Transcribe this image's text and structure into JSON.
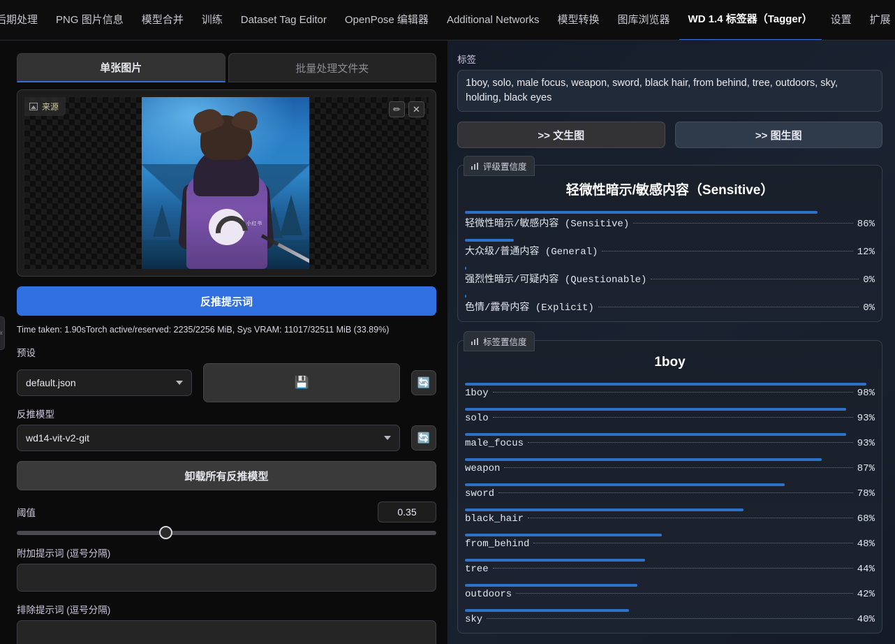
{
  "nav": {
    "items": [
      {
        "label": "后期处理",
        "active": false
      },
      {
        "label": "PNG 图片信息",
        "active": false
      },
      {
        "label": "模型合并",
        "active": false
      },
      {
        "label": "训练",
        "active": false
      },
      {
        "label": "Dataset Tag Editor",
        "active": false
      },
      {
        "label": "OpenPose 编辑器",
        "active": false
      },
      {
        "label": "Additional Networks",
        "active": false
      },
      {
        "label": "模型转换",
        "active": false
      },
      {
        "label": "图库浏览器",
        "active": false
      },
      {
        "label": "WD 1.4 标签器（Tagger）",
        "active": true
      },
      {
        "label": "设置",
        "active": false
      },
      {
        "label": "扩展",
        "active": false
      }
    ]
  },
  "left": {
    "collapse_handle": "«",
    "tabs": [
      {
        "label": "单张图片",
        "selected": true
      },
      {
        "label": "批量处理文件夹",
        "selected": false
      }
    ],
    "image": {
      "source_badge": "来源",
      "edit_icon": "✏",
      "close_icon": "✕",
      "watermark": "小红书"
    },
    "interrogate_button": "反推提示词",
    "status": "Time taken: 1.90sTorch active/reserved: 2235/2256 MiB, Sys VRAM: 11017/32511 MiB (33.89%)",
    "preset_label": "预设",
    "preset_value": "default.json",
    "save_icon": "💾",
    "refresh_icon": "🔄",
    "model_label": "反推模型",
    "model_value": "wd14-vit-v2-git",
    "unload_button": "卸载所有反推模型",
    "threshold_label": "阈值",
    "threshold_value": "0.35",
    "additional_label": "附加提示词 (逗号分隔)",
    "additional_value": "",
    "exclude_label": "排除提示词 (逗号分隔)",
    "exclude_value": ""
  },
  "right": {
    "tags_label": "标签",
    "tags_value": "1boy, solo, male focus, weapon, sword, black hair, from behind, tree, outdoors, sky, holding, black eyes",
    "send_txt2img": ">> 文生图",
    "send_img2img": ">> 图生图",
    "rating_card_label": "评级置信度",
    "rating_title": "轻微性暗示/敏感内容（Sensitive）",
    "tag_card_label": "标签置信度",
    "tag_title": "1boy"
  },
  "chart_data": [
    {
      "type": "bar",
      "title": "评级置信度",
      "orientation": "horizontal",
      "categories": [
        "轻微性暗示/敏感内容 (Sensitive)",
        "大众级/普通内容 (General)",
        "强烈性暗示/可疑内容 (Questionable)",
        "色情/露骨内容 (Explicit)"
      ],
      "values": [
        86,
        12,
        0,
        0
      ],
      "labels": [
        "86%",
        "12%",
        "0%",
        "0%"
      ],
      "ylim": [
        0,
        100
      ],
      "xlabel": "",
      "ylabel": "",
      "grid": false,
      "legend": "none",
      "bar_color": "#2d72c8"
    },
    {
      "type": "bar",
      "title": "标签置信度",
      "orientation": "horizontal",
      "categories": [
        "1boy",
        "solo",
        "male_focus",
        "weapon",
        "sword",
        "black_hair",
        "from_behind",
        "tree",
        "outdoors",
        "sky"
      ],
      "values": [
        98,
        93,
        93,
        87,
        78,
        68,
        48,
        44,
        42,
        40
      ],
      "labels": [
        "98%",
        "93%",
        "93%",
        "87%",
        "78%",
        "68%",
        "48%",
        "44%",
        "42%",
        "40%"
      ],
      "ylim": [
        0,
        100
      ],
      "xlabel": "",
      "ylabel": "",
      "grid": false,
      "legend": "none",
      "bar_color": "#2d72c8"
    }
  ]
}
